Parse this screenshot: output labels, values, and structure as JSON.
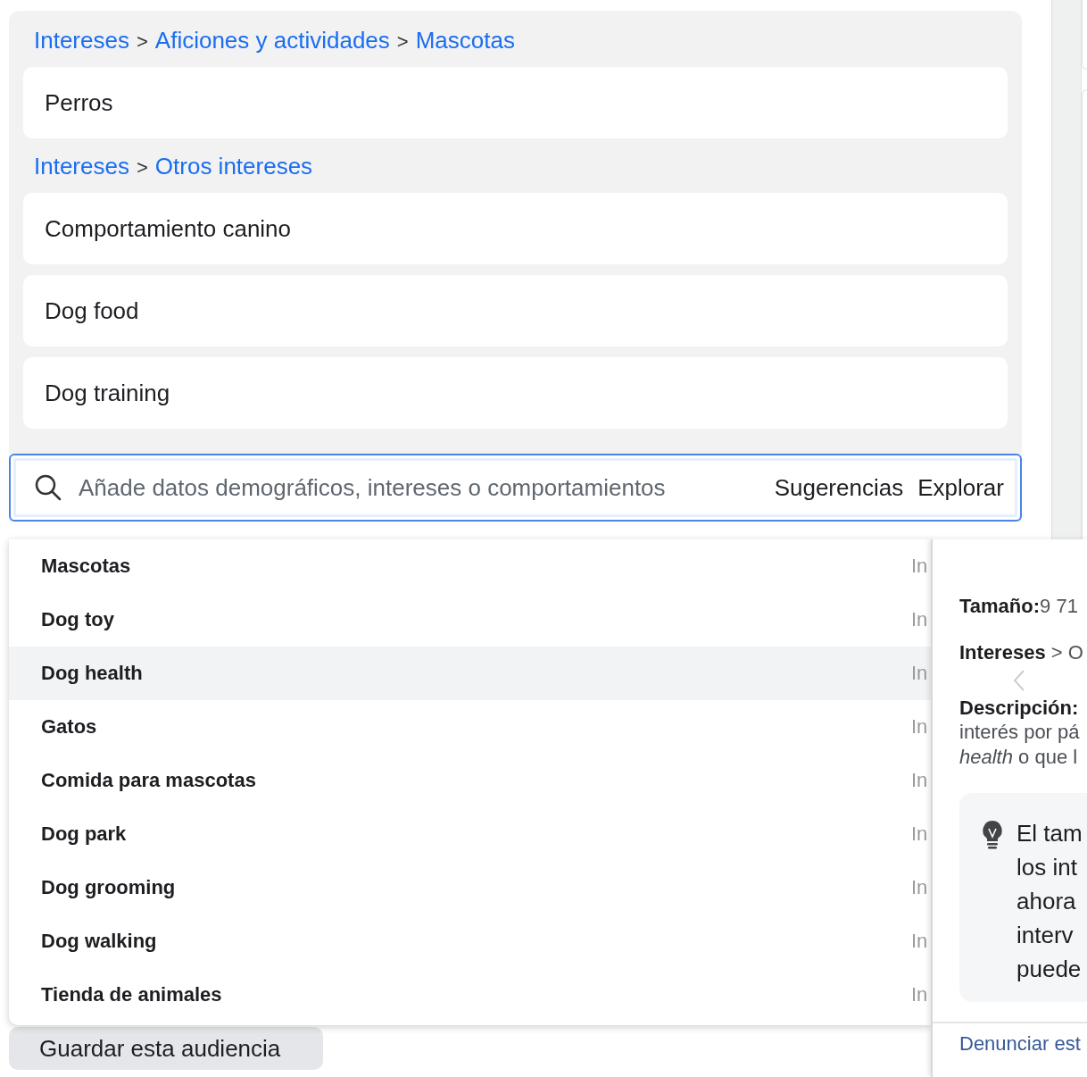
{
  "targeting": {
    "groups": [
      {
        "breadcrumb": [
          "Intereses",
          "Aficiones y actividades",
          "Mascotas"
        ],
        "separator": ">",
        "items": [
          "Perros"
        ]
      },
      {
        "breadcrumb": [
          "Intereses",
          "Otros intereses"
        ],
        "separator": ">",
        "items": [
          "Comportamiento canino",
          "Dog food",
          "Dog training"
        ]
      }
    ],
    "search": {
      "placeholder": "Añade datos demográficos, intereses o comportamientos",
      "actions": [
        "Sugerencias",
        "Explorar"
      ]
    }
  },
  "suggestions": [
    {
      "name": "Mascotas",
      "category": "In",
      "selected": false
    },
    {
      "name": "Dog toy",
      "category": "In",
      "selected": false
    },
    {
      "name": "Dog health",
      "category": "In",
      "selected": true
    },
    {
      "name": "Gatos",
      "category": "In",
      "selected": false
    },
    {
      "name": "Comida para mascotas",
      "category": "In",
      "selected": false
    },
    {
      "name": "Dog park",
      "category": "In",
      "selected": false
    },
    {
      "name": "Dog grooming",
      "category": "In",
      "selected": false
    },
    {
      "name": "Dog walking",
      "category": "In",
      "selected": false
    },
    {
      "name": "Tienda de animales",
      "category": "In",
      "selected": false
    }
  ],
  "save_button": "Guardar esta audiencia",
  "detail": {
    "size_label": "Tamaño:",
    "size_value": "9 71",
    "path": [
      "Intereses",
      "O"
    ],
    "separator": ">",
    "description_label": "Descripción:",
    "description_lines": [
      "interés por pá",
      "*health* o que l"
    ],
    "tip_lines": [
      "El tam",
      "los int",
      "ahora",
      "interv",
      "puede"
    ],
    "report_link": "Denunciar est"
  }
}
